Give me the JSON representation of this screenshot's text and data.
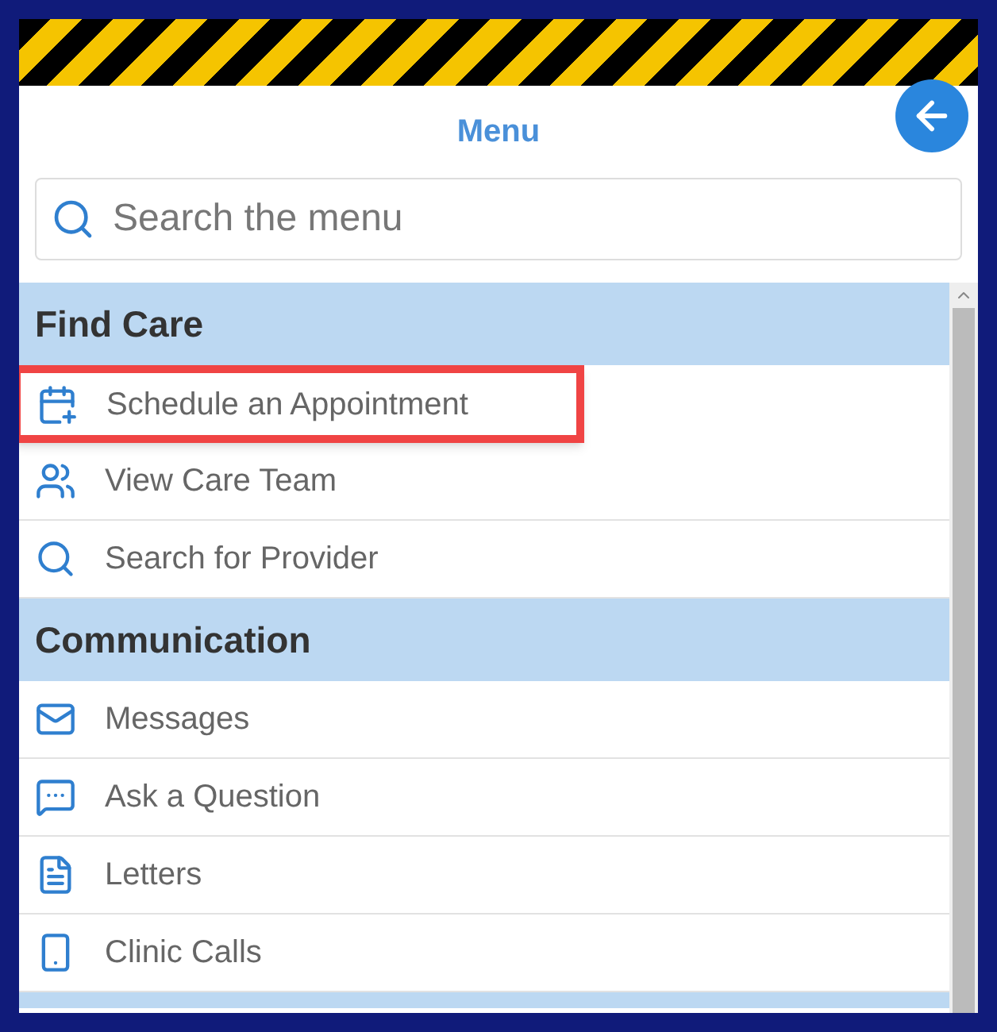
{
  "header": {
    "title": "Menu"
  },
  "search": {
    "placeholder": "Search the menu"
  },
  "sections": [
    {
      "title": "Find Care",
      "items": [
        {
          "label": "Schedule an Appointment",
          "highlighted": true
        },
        {
          "label": "View Care Team",
          "highlighted": false
        },
        {
          "label": "Search for Provider",
          "highlighted": false
        }
      ]
    },
    {
      "title": "Communication",
      "items": [
        {
          "label": "Messages",
          "highlighted": false
        },
        {
          "label": "Ask a Question",
          "highlighted": false
        },
        {
          "label": "Letters",
          "highlighted": false
        },
        {
          "label": "Clinic Calls",
          "highlighted": false
        }
      ]
    }
  ]
}
